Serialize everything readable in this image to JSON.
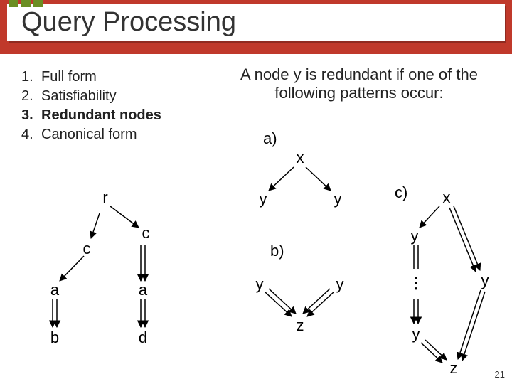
{
  "title": "Query Processing",
  "list": [
    {
      "num": "1.",
      "text": "Full form"
    },
    {
      "num": "2.",
      "text": "Satisfiability"
    },
    {
      "num": "3.",
      "text": "Redundant nodes"
    },
    {
      "num": "4.",
      "text": "Canonical form"
    }
  ],
  "definition": "A node y is redundant if one of the following patterns occur:",
  "labels": {
    "a": "a)",
    "b": "b)",
    "c": "c)"
  },
  "nodes": {
    "r": "r",
    "c": "c",
    "a": "a",
    "b": "b",
    "d": "d",
    "x": "x",
    "y": "y",
    "z": "z",
    "dots": "⋮"
  },
  "page": "21"
}
